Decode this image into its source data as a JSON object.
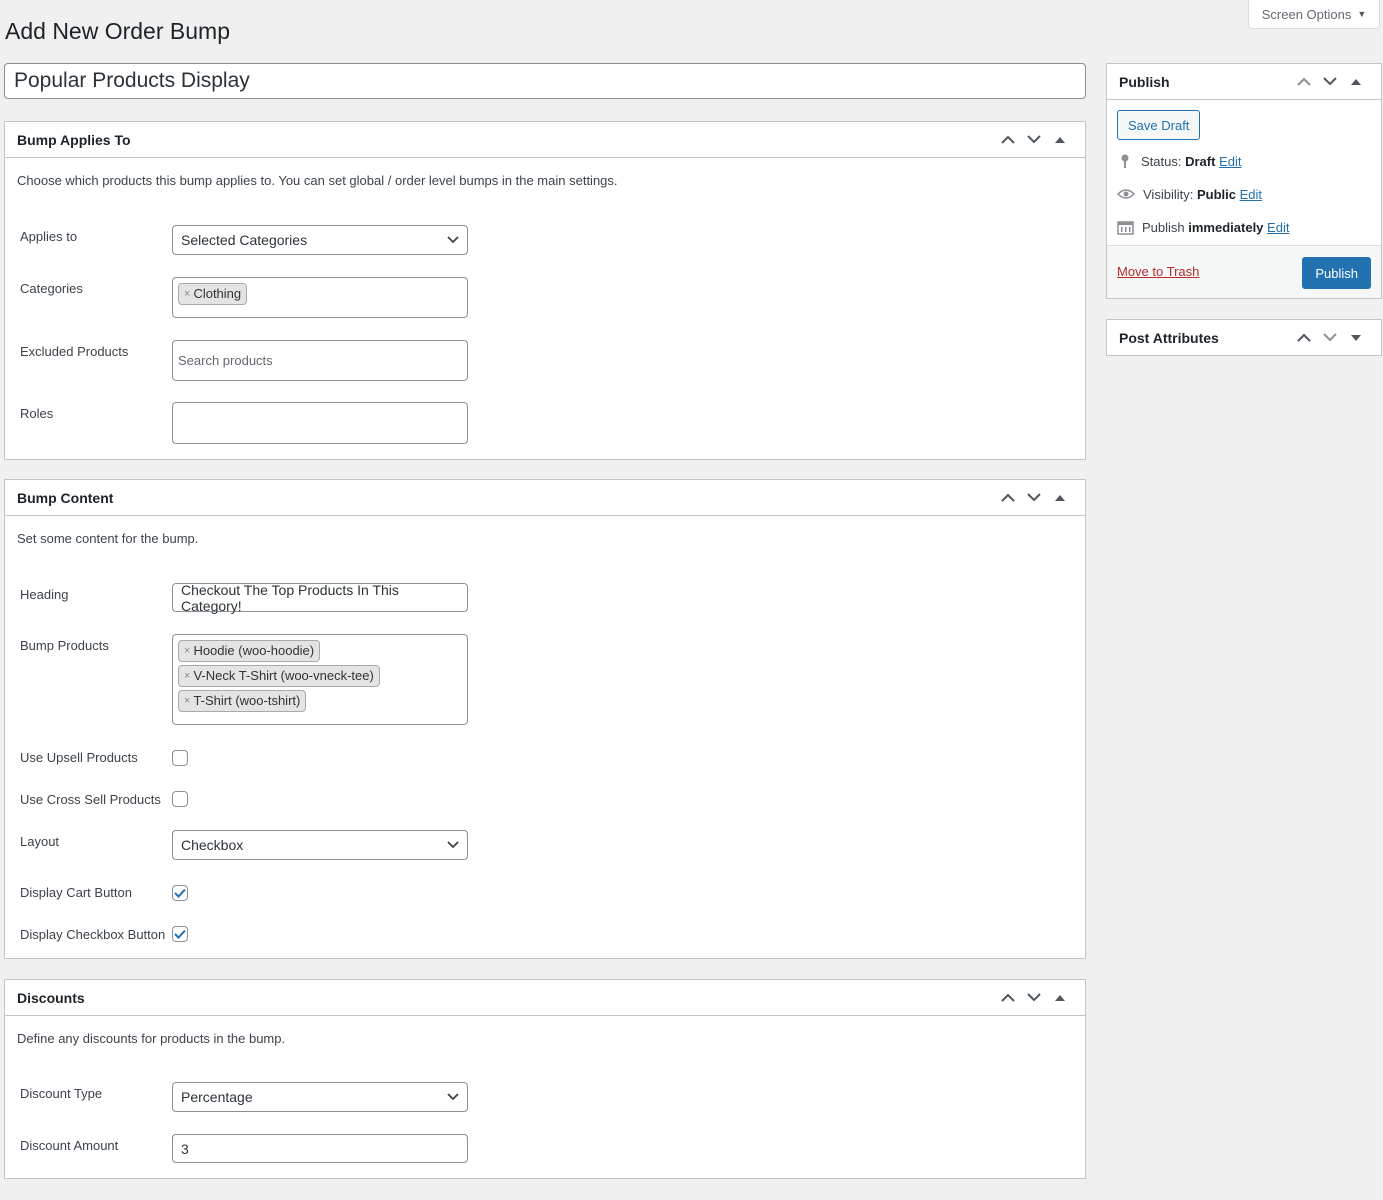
{
  "header": {
    "screen_options": "Screen Options",
    "page_title": "Add New Order Bump",
    "post_title": "Popular Products Display"
  },
  "bump_applies_to": {
    "title": "Bump Applies To",
    "description": "Choose which products this bump applies to. You can set global / order level bumps in the main settings.",
    "applies_to_label": "Applies to",
    "applies_to_value": "Selected Categories",
    "categories_label": "Categories",
    "categories": [
      "Clothing"
    ],
    "excluded_label": "Excluded Products",
    "excluded_placeholder": "Search products",
    "roles_label": "Roles"
  },
  "bump_content": {
    "title": "Bump Content",
    "description": "Set some content for the bump.",
    "heading_label": "Heading",
    "heading_value": "Checkout The Top Products In This Category!",
    "bump_products_label": "Bump Products",
    "bump_products": [
      "Hoodie (woo-hoodie)",
      "V-Neck T-Shirt (woo-vneck-tee)",
      "T-Shirt (woo-tshirt)"
    ],
    "upsell_label": "Use Upsell Products",
    "upsell_checked": false,
    "cross_sell_label": "Use Cross Sell Products",
    "cross_sell_checked": false,
    "layout_label": "Layout",
    "layout_value": "Checkbox",
    "cart_button_label": "Display Cart Button",
    "cart_button_checked": true,
    "checkbox_button_label": "Display Checkbox Button",
    "checkbox_button_checked": true
  },
  "discounts": {
    "title": "Discounts",
    "description": "Define any discounts for products in the bump.",
    "type_label": "Discount Type",
    "type_value": "Percentage",
    "amount_label": "Discount Amount",
    "amount_value": "3"
  },
  "publish": {
    "title": "Publish",
    "save_draft": "Save Draft",
    "status_label": "Status:",
    "status_value": "Draft",
    "visibility_label": "Visibility:",
    "visibility_value": "Public",
    "publish_label": "Publish",
    "publish_value": "immediately",
    "edit": "Edit",
    "move_to_trash": "Move to Trash",
    "publish_button": "Publish"
  },
  "post_attributes": {
    "title": "Post Attributes"
  },
  "colors": {
    "accent": "#2271b1",
    "trash": "#b32d2e",
    "background": "#f0f0f1"
  }
}
